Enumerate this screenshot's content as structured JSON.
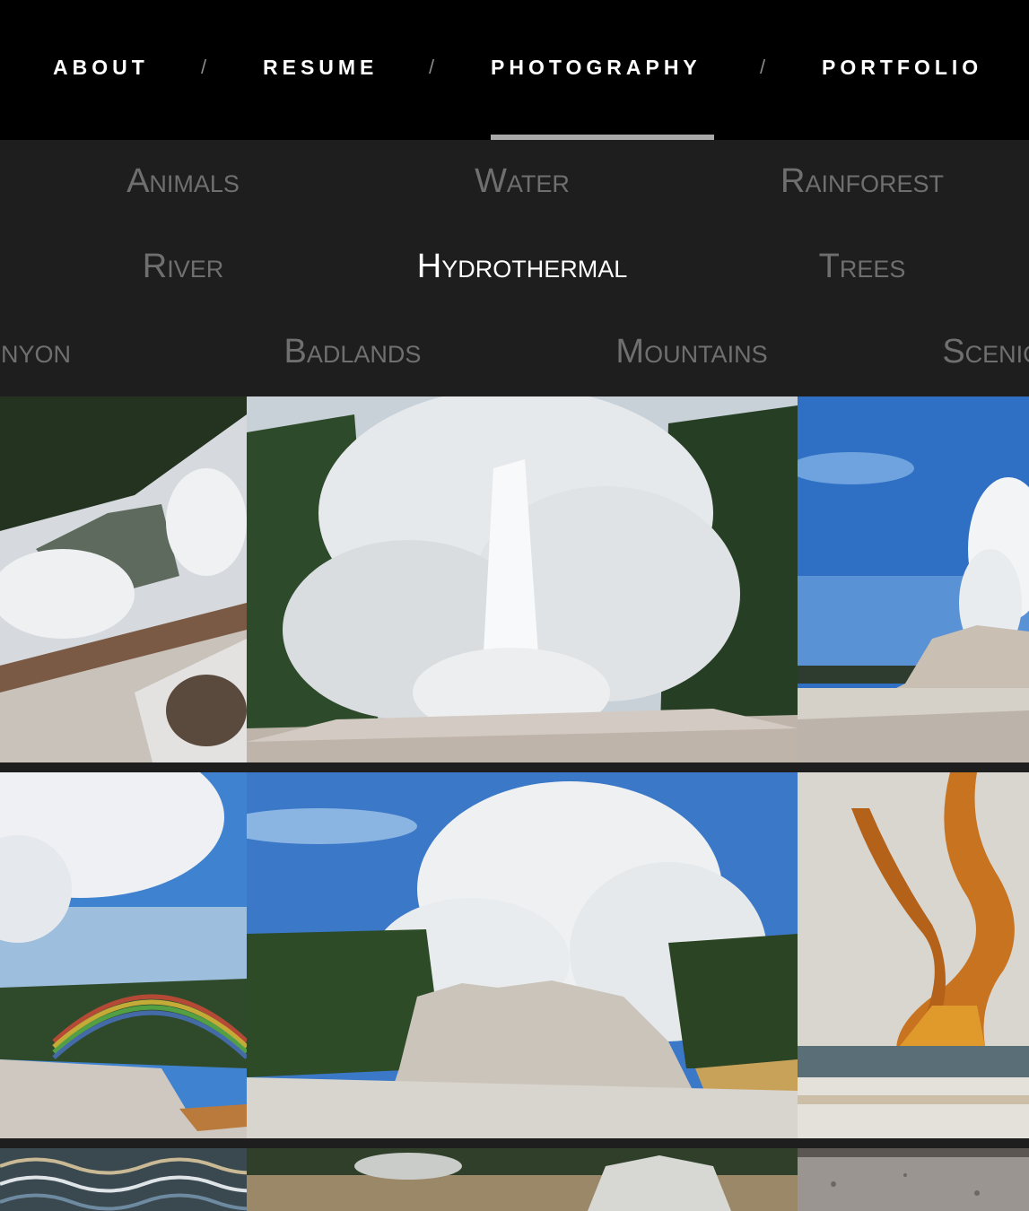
{
  "nav": {
    "items": [
      "ABOUT",
      "RESUME",
      "PHOTOGRAPHY",
      "PORTFOLIO"
    ],
    "separator": "/",
    "active": "PHOTOGRAPHY"
  },
  "categories": {
    "row1": [
      "Animals",
      "Water",
      "Rainforest"
    ],
    "row2": [
      "River",
      "Hydrothermal",
      "Trees"
    ],
    "row3": [
      "nyon",
      "Badlands",
      "Mountains",
      "Scenic"
    ],
    "active": "Hydrothermal"
  },
  "colors": {
    "nav_bg": "#000000",
    "menu_bg": "#1e1e1e",
    "inactive_text": "#6f6f6f",
    "active_text": "#ffffff",
    "underline": "#a9a9a9"
  }
}
